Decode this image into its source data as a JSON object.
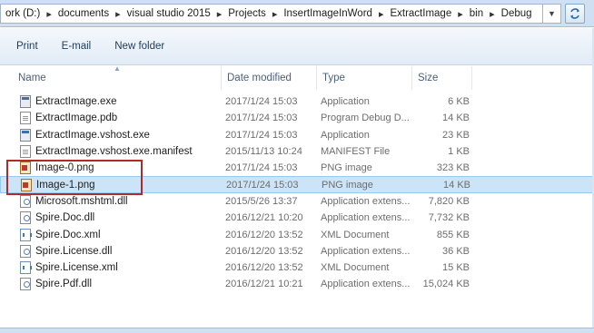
{
  "address": {
    "crumbs": [
      "ork (D:)",
      "documents",
      "visual studio 2015",
      "Projects",
      "InsertImageInWord",
      "ExtractImage",
      "bin",
      "Debug"
    ]
  },
  "toolbar": {
    "print_label": "Print",
    "email_label": "E-mail",
    "new_folder_label": "New folder"
  },
  "columns": {
    "name": "Name",
    "date": "Date modified",
    "type": "Type",
    "size": "Size"
  },
  "files": [
    {
      "name": "ExtractImage.exe",
      "date": "2017/1/24 15:03",
      "type": "Application",
      "size": "6 KB",
      "icon": "exe-icon"
    },
    {
      "name": "ExtractImage.pdb",
      "date": "2017/1/24 15:03",
      "type": "Program Debug D...",
      "size": "14 KB",
      "icon": "pdb-icon"
    },
    {
      "name": "ExtractImage.vshost.exe",
      "date": "2017/1/24 15:03",
      "type": "Application",
      "size": "23 KB",
      "icon": "exe-icon"
    },
    {
      "name": "ExtractImage.vshost.exe.manifest",
      "date": "2015/11/13 10:24",
      "type": "MANIFEST File",
      "size": "1 KB",
      "icon": "manifest-icon"
    },
    {
      "name": "Image-0.png",
      "date": "2017/1/24 15:03",
      "type": "PNG image",
      "size": "323 KB",
      "icon": "png-icon"
    },
    {
      "name": "Image-1.png",
      "date": "2017/1/24 15:03",
      "type": "PNG image",
      "size": "14 KB",
      "icon": "png-icon",
      "selected": true
    },
    {
      "name": "Microsoft.mshtml.dll",
      "date": "2015/5/26 13:37",
      "type": "Application extens...",
      "size": "7,820 KB",
      "icon": "dll-icon"
    },
    {
      "name": "Spire.Doc.dll",
      "date": "2016/12/21 10:20",
      "type": "Application extens...",
      "size": "7,732 KB",
      "icon": "dll-icon"
    },
    {
      "name": "Spire.Doc.xml",
      "date": "2016/12/20 13:52",
      "type": "XML Document",
      "size": "855 KB",
      "icon": "xml-icon"
    },
    {
      "name": "Spire.License.dll",
      "date": "2016/12/20 13:52",
      "type": "Application extens...",
      "size": "36 KB",
      "icon": "dll-icon"
    },
    {
      "name": "Spire.License.xml",
      "date": "2016/12/20 13:52",
      "type": "XML Document",
      "size": "15 KB",
      "icon": "xml-icon"
    },
    {
      "name": "Spire.Pdf.dll",
      "date": "2016/12/21 10:21",
      "type": "Application extens...",
      "size": "15,024 KB",
      "icon": "dll-icon"
    }
  ],
  "colors": {
    "selection": "#cce4f7",
    "highlight_box": "#b02a2a",
    "chrome": "#cfe0f3"
  }
}
